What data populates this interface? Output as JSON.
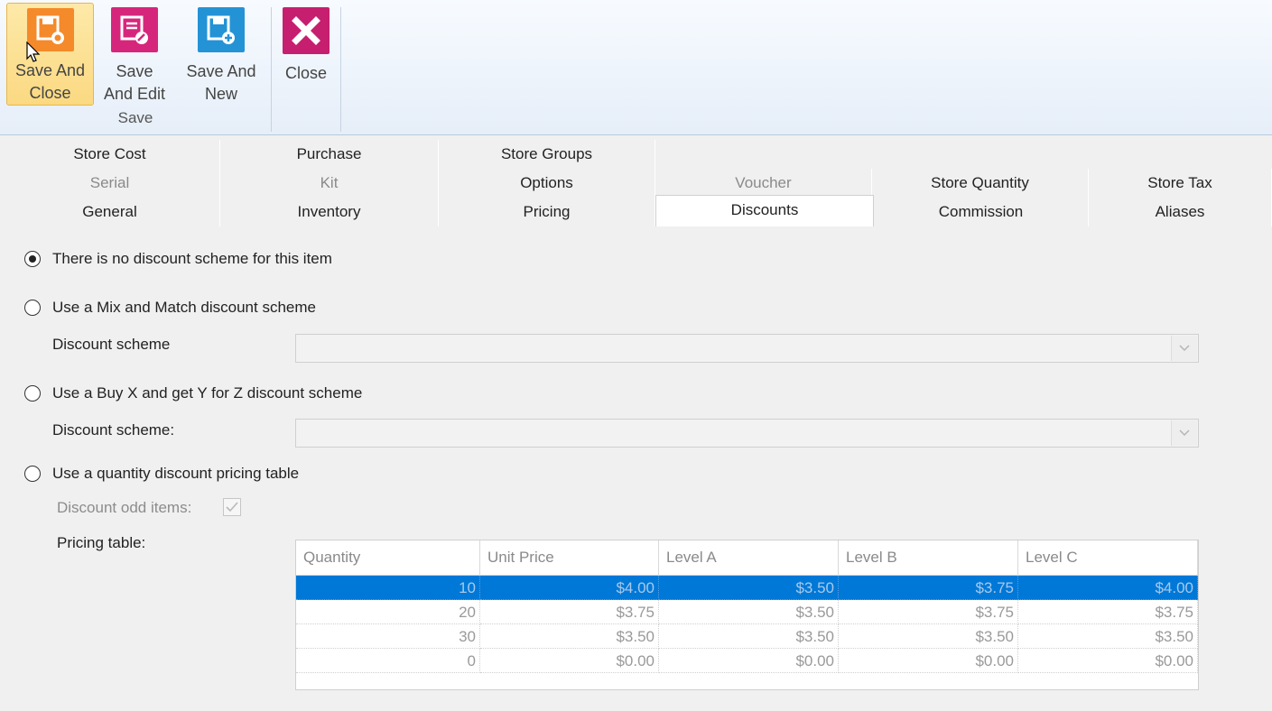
{
  "ribbon": {
    "buttons": [
      {
        "label": "Save And\nClose",
        "icon": "save-close-icon",
        "color": "#f58a2a"
      },
      {
        "label": "Save\nAnd Edit",
        "icon": "save-edit-icon",
        "color": "#d6267c"
      },
      {
        "label": "Save And\nNew",
        "icon": "save-new-icon",
        "color": "#2393d6"
      },
      {
        "label": "Close",
        "icon": "close-icon",
        "color": "#c61f6f"
      }
    ],
    "group_label": "Save"
  },
  "tabs": {
    "row1": [
      "Store Cost",
      "Purchase",
      "Store Groups"
    ],
    "row2": [
      "Serial",
      "Kit",
      "Options",
      "Voucher",
      "Store Quantity",
      "Store Tax"
    ],
    "row3": [
      "General",
      "Inventory",
      "Pricing",
      "Discounts",
      "Commission",
      "Aliases"
    ],
    "active": "Discounts"
  },
  "discounts": {
    "option_none": "There is no discount scheme for this item",
    "option_mix": "Use a Mix and Match discount scheme",
    "mix_label": "Discount scheme",
    "mix_value": "",
    "option_buyx": "Use a Buy X and get Y for Z discount scheme",
    "buyx_label": "Discount scheme:",
    "buyx_value": "",
    "option_qty": "Use a quantity discount pricing table",
    "odd_items_label": "Discount odd items:",
    "odd_items_checked": true,
    "pricing_label": "Pricing table:",
    "selected_option": "none"
  },
  "pricing_table": {
    "columns": [
      "Quantity",
      "Unit Price",
      "Level A",
      "Level B",
      "Level C"
    ],
    "rows": [
      [
        "10",
        "$4.00",
        "$3.50",
        "$3.75",
        "$4.00"
      ],
      [
        "20",
        "$3.75",
        "$3.50",
        "$3.75",
        "$3.75"
      ],
      [
        "30",
        "$3.50",
        "$3.50",
        "$3.50",
        "$3.50"
      ],
      [
        "0",
        "$0.00",
        "$0.00",
        "$0.00",
        "$0.00"
      ]
    ],
    "selected_row": 0
  },
  "colors": {
    "selection": "#0078d7",
    "hover_button": "#fbd982"
  }
}
